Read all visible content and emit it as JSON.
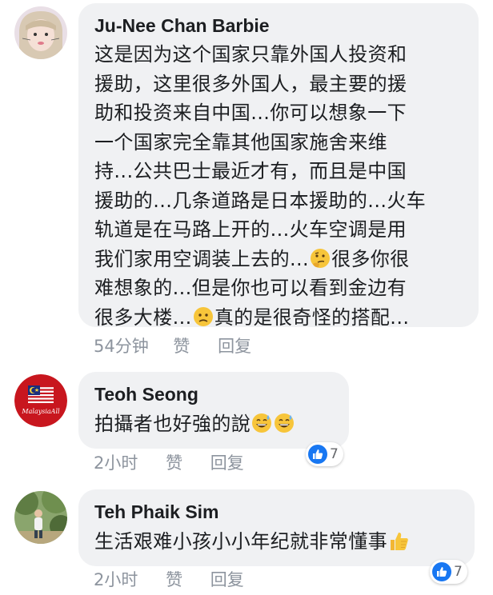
{
  "comments": [
    {
      "author": "Ju-Nee Chan Barbie",
      "lines": [
        "这是因为这个国家只靠外国人投资和",
        "援助，这里很多外国人，最主要的援",
        "助和投资来自中国...你可以想象一下",
        "一个国家完全靠其他国家施舍来维",
        "持...公共巴士最近才有，而且是中国",
        "援助的...几条道路是日本援助的...火车",
        "轨道是在马路上开的...火车空调是用"
      ],
      "line8a": "我们家用空调装上去的...",
      "line8b": "很多你很",
      "line9": "难想象的...但是你也可以看到金边有",
      "line10a": "很多大楼...",
      "line10b": "真的是很奇怪的搭配...",
      "time": "54分钟",
      "like": "赞",
      "reply": "回复"
    },
    {
      "author": "Teoh Seong",
      "avatar_text": "MalaysiaAll",
      "text": "拍攝者也好強的說",
      "time": "2小时",
      "like": "赞",
      "reply": "回复",
      "reactions": "7"
    },
    {
      "author": "Teh Phaik Sim",
      "text": "生活艰难小孩小小年纪就非常懂事",
      "time": "2小时",
      "like": "赞",
      "reply": "回复",
      "reactions": "7"
    }
  ],
  "colors": {
    "bubble": "#f0f1f3",
    "text": "#1c1e21",
    "meta": "#8d949e",
    "like_blue": "#1877f2"
  },
  "icons": [
    "thinking-emoji-icon",
    "frown-emoji-icon",
    "grin-sweat-emoji-icon",
    "thumbs-up-emoji-icon",
    "like-reaction-icon"
  ]
}
